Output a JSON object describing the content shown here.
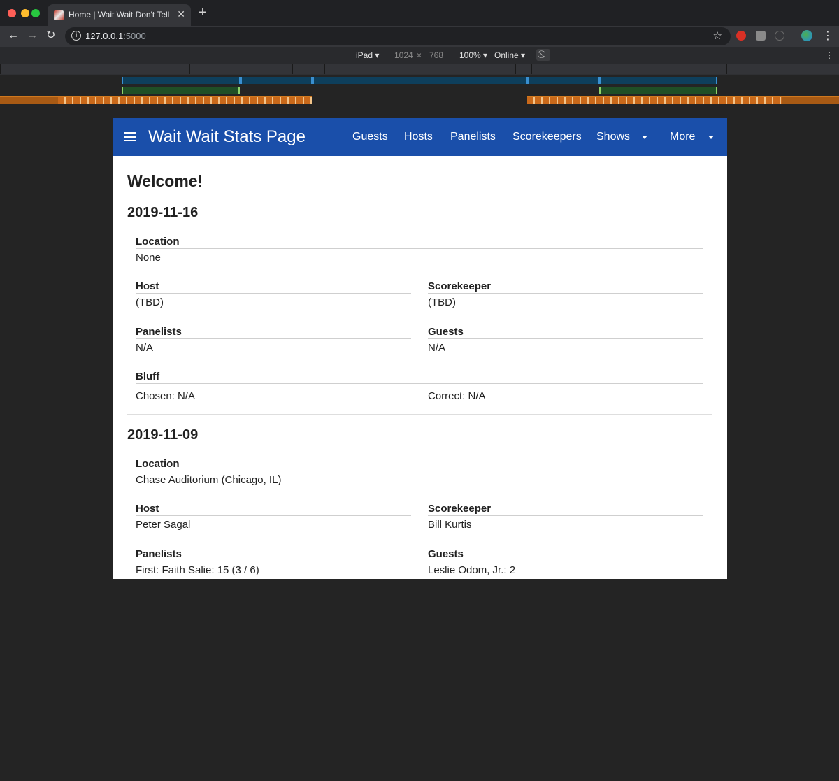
{
  "browser": {
    "tab_title": "Home | Wait Wait Don't Tell Me",
    "url_host": "127.0.0.1",
    "url_port": ":5000"
  },
  "device_toolbar": {
    "device": "iPad",
    "width": "1024",
    "height": "768",
    "zoom": "100%",
    "network": "Online"
  },
  "app": {
    "title": "Wait Wait Stats Page",
    "nav": [
      "Guests",
      "Hosts",
      "Panelists",
      "Scorekeepers",
      "Shows",
      "More"
    ]
  },
  "page": {
    "heading": "Welcome!",
    "shows": [
      {
        "date": "2019-11-16",
        "location_label": "Location",
        "location": "None",
        "host_label": "Host",
        "host": "(TBD)",
        "scorekeeper_label": "Scorekeeper",
        "scorekeeper": "(TBD)",
        "panelists_label": "Panelists",
        "panelists": "N/A",
        "guests_label": "Guests",
        "guests": "N/A",
        "bluff_label": "Bluff",
        "bluff_chosen": "Chosen: N/A",
        "bluff_correct": "Correct: N/A"
      },
      {
        "date": "2019-11-09",
        "location_label": "Location",
        "location": "Chase Auditorium (Chicago, IL)",
        "host_label": "Host",
        "host": "Peter Sagal",
        "scorekeeper_label": "Scorekeeper",
        "scorekeeper": "Bill Kurtis",
        "panelists_label": "Panelists",
        "panelists_first": "First: Faith Salie: 15 (3 / 6)",
        "guests_label": "Guests",
        "guests_first": "Leslie Odom, Jr.: 2"
      }
    ]
  },
  "colors": {
    "app_bar": "#1a4faa",
    "page_bg": "#ffffff",
    "chrome_bg": "#242424"
  }
}
